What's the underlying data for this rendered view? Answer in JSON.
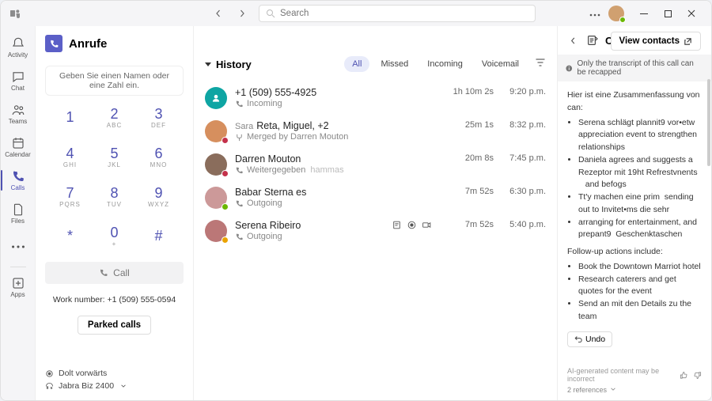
{
  "titlebar": {
    "search_placeholder": "Search"
  },
  "rail": {
    "activity": "Activity",
    "chat": "Chat",
    "teams": "Teams",
    "calendar": "Calendar",
    "calls": "Calls",
    "files": "Files",
    "apps": "Apps"
  },
  "dialer": {
    "title": "Anrufe",
    "input_placeholder": "Geben Sie einen Namen oder eine Zahl ein.",
    "keys": [
      {
        "d": "1",
        "l": ""
      },
      {
        "d": "2",
        "l": "ABC"
      },
      {
        "d": "3",
        "l": "DEF"
      },
      {
        "d": "4",
        "l": "GHI"
      },
      {
        "d": "5",
        "l": "JKL"
      },
      {
        "d": "6",
        "l": "MNO"
      },
      {
        "d": "7",
        "l": "PQRS"
      },
      {
        "d": "8",
        "l": "TUV"
      },
      {
        "d": "9",
        "l": "WXYZ"
      },
      {
        "d": "*",
        "l": ""
      },
      {
        "d": "0",
        "l": "+"
      },
      {
        "d": "#",
        "l": ""
      }
    ],
    "call_label": "Call",
    "work_number": "Work number: +1 (509) 555-0594",
    "parked": "Parked calls",
    "forward": "Dolt vorwärts",
    "device": "Jabra Biz 2400"
  },
  "contacts_btn": "View contacts",
  "history": {
    "title": "History",
    "filters": {
      "all": "All",
      "missed": "Missed",
      "incoming": "Incoming",
      "voicemail": "Voicemail"
    },
    "rows": [
      {
        "title": "+1 (509) 555-4925",
        "sub_icon": "call",
        "sub": "Incoming",
        "dur": "1h 10m 2s",
        "time": "9:20 p.m.",
        "avatar": "teal"
      },
      {
        "title_pre": "Sara",
        "title": "Reta, Miguel, +2",
        "sub_icon": "merge",
        "sub": "Merged by Darren Mouton",
        "dur": "25m 1s",
        "time": "8:32 p.m.",
        "avatar": "img1",
        "status": "red"
      },
      {
        "title": "Darren Mouton",
        "sub_icon": "call",
        "sub": "Weitergegeben",
        "sub2": "hammas",
        "dur": "20m 8s",
        "time": "7:45 p.m.",
        "avatar": "img2",
        "status": "red"
      },
      {
        "title": "Babar Sterna es",
        "sub_icon": "call",
        "sub": "Outgoing",
        "dur": "7m 52s",
        "time": "6:30 p.m.",
        "avatar": "img3",
        "status": "green"
      },
      {
        "title": "Serena Ribeiro",
        "sub_icon": "call",
        "sub": "Outgoing",
        "dur": "7m 52s",
        "time": "5:40 p.m.",
        "avatar": "img4",
        "status": "yellow",
        "active": true
      }
    ]
  },
  "recap": {
    "title": "Call recap",
    "note": "Only the transcript of this call can be recapped",
    "intro": "Hier ist eine Zusammenfassung von can:",
    "bullets": [
      "Serena schlägt plannit9 vor•etw appreciation event to strengthen relationships",
      "Daniela agrees and suggests a Rezeptor mit 19ht Refrestvnents    and befogs",
      "Tt'y machen eine prim  sending out to Invitet•ms die sehr",
      "arranging for entertainment, and prepant9  Geschenktaschen"
    ],
    "followup_title": "Follow-up actions include:",
    "followups": [
      "Book the Downtown Marriot hotel",
      "Research caterers and get quotes for the event",
      "Send an mit den Details zu the team"
    ],
    "undo": "Undo",
    "disclaimer": "AI-generated content may be incorrect",
    "references": "2 references"
  }
}
